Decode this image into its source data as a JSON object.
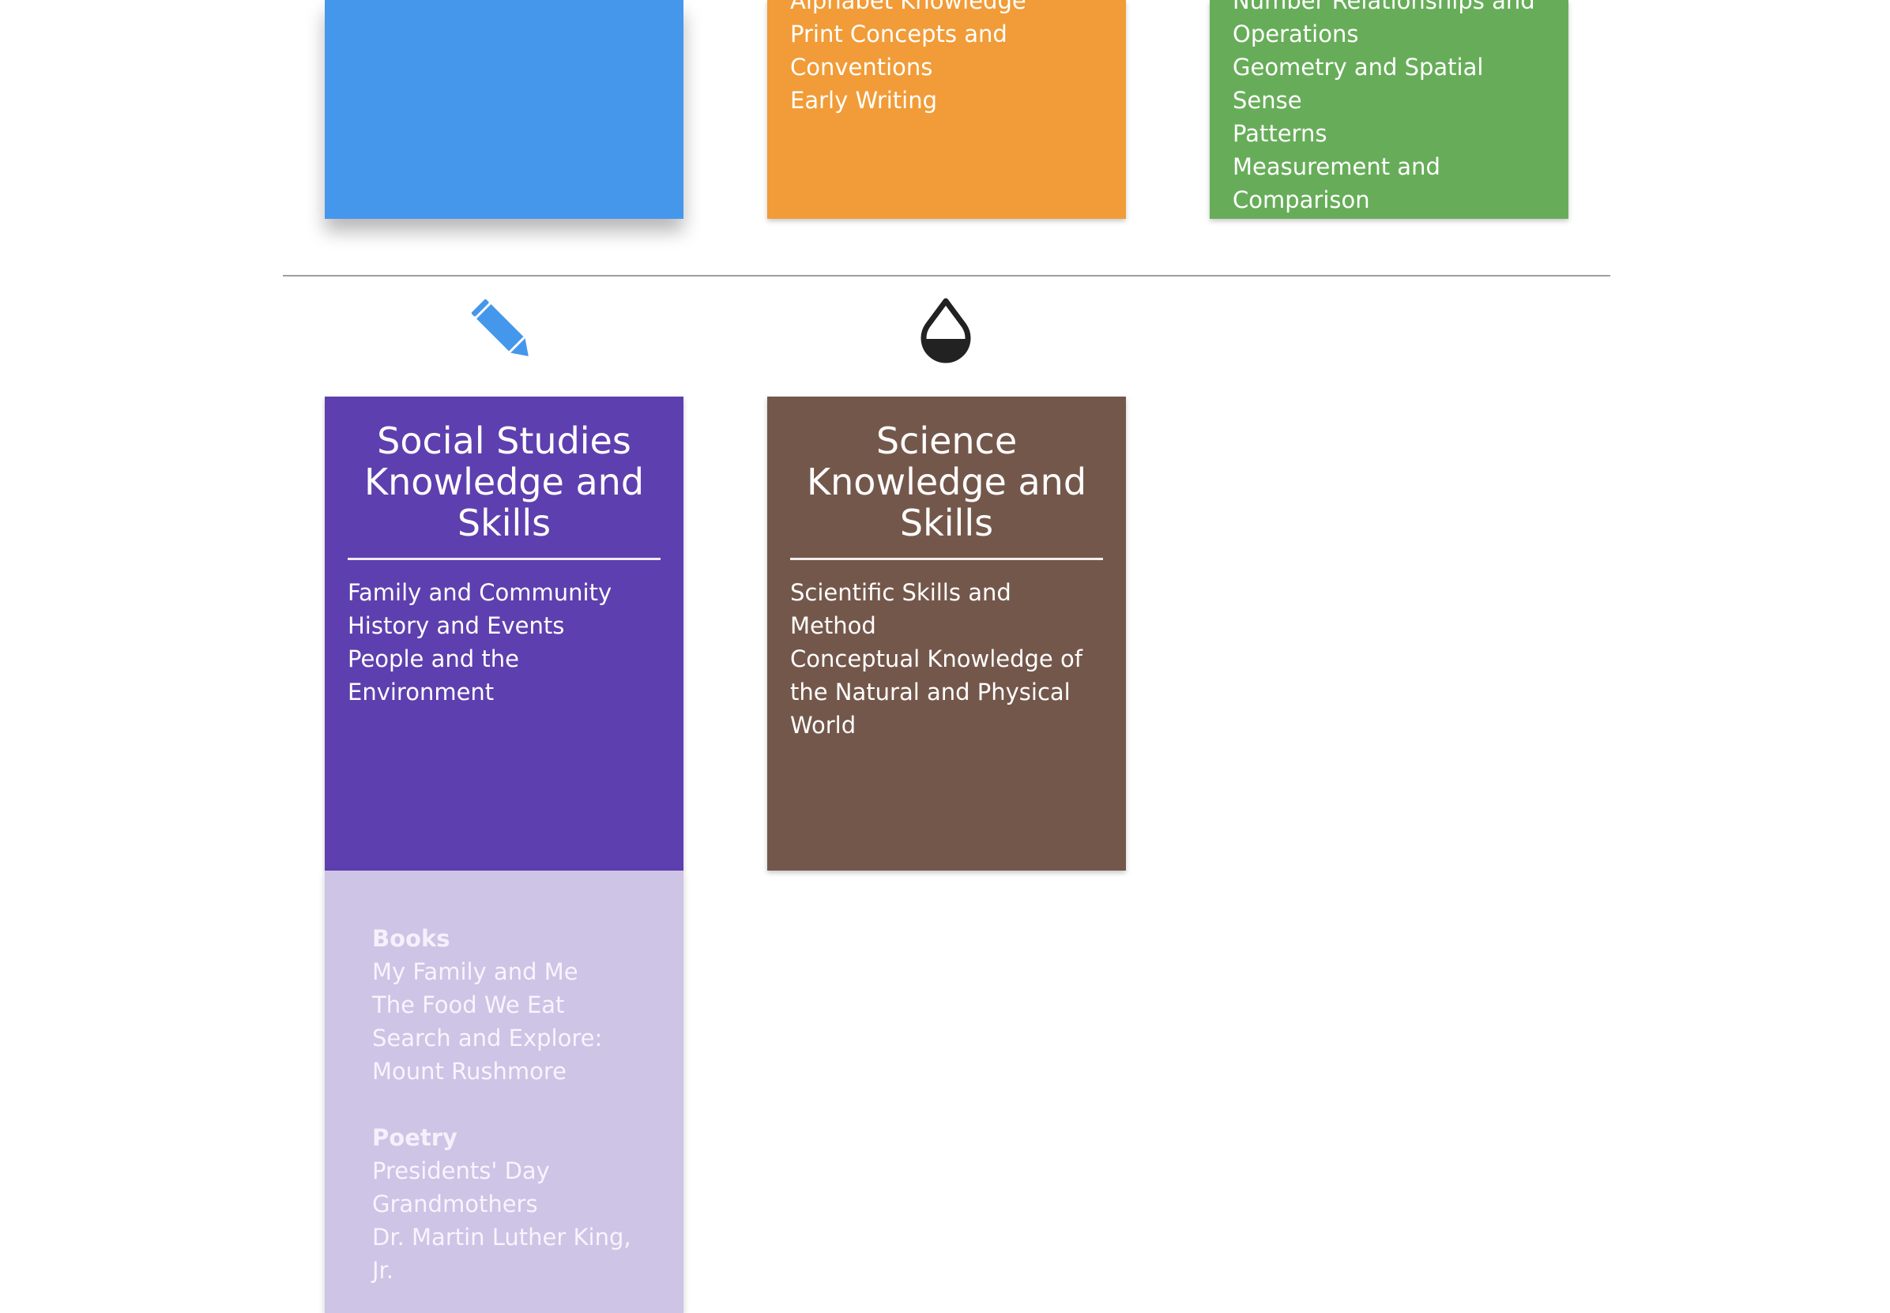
{
  "top_cards": {
    "blue": {
      "color": "#4597eb",
      "items": []
    },
    "orange": {
      "color": "#f19c38",
      "items": [
        "Alphabet Knowledge",
        "Print Concepts and Conventions",
        "Early Writing"
      ]
    },
    "green": {
      "color": "#67ad59",
      "items": [
        "Number Relationships and Operations",
        "Geometry and Spatial Sense",
        "Patterns",
        "Measurement and Comparison"
      ]
    }
  },
  "subjects": [
    {
      "icon": "pencil-icon",
      "icon_color": "#4597eb",
      "title": "Social Studies Knowledge and Skills",
      "color": "#5e3faf",
      "items": [
        "Family and Community",
        "History and Events",
        "People and the Environment"
      ]
    },
    {
      "icon": "half-drop-icon",
      "icon_color": "#222222",
      "title": "Science Knowledge and Skills",
      "color": "#74574b",
      "items": [
        "Scientific Skills and Method",
        "Conceptual Knowledge of the Natural and Physical World"
      ]
    }
  ],
  "resources": {
    "color": "#cdc4e6",
    "groups": [
      {
        "heading": "Books",
        "items": [
          "My Family and Me",
          "The Food We Eat",
          "Search and Explore: Mount Rushmore"
        ]
      },
      {
        "heading": "Poetry",
        "items": [
          "Presidents' Day",
          "Grandmothers",
          "Dr. Martin Luther King, Jr."
        ]
      }
    ]
  }
}
